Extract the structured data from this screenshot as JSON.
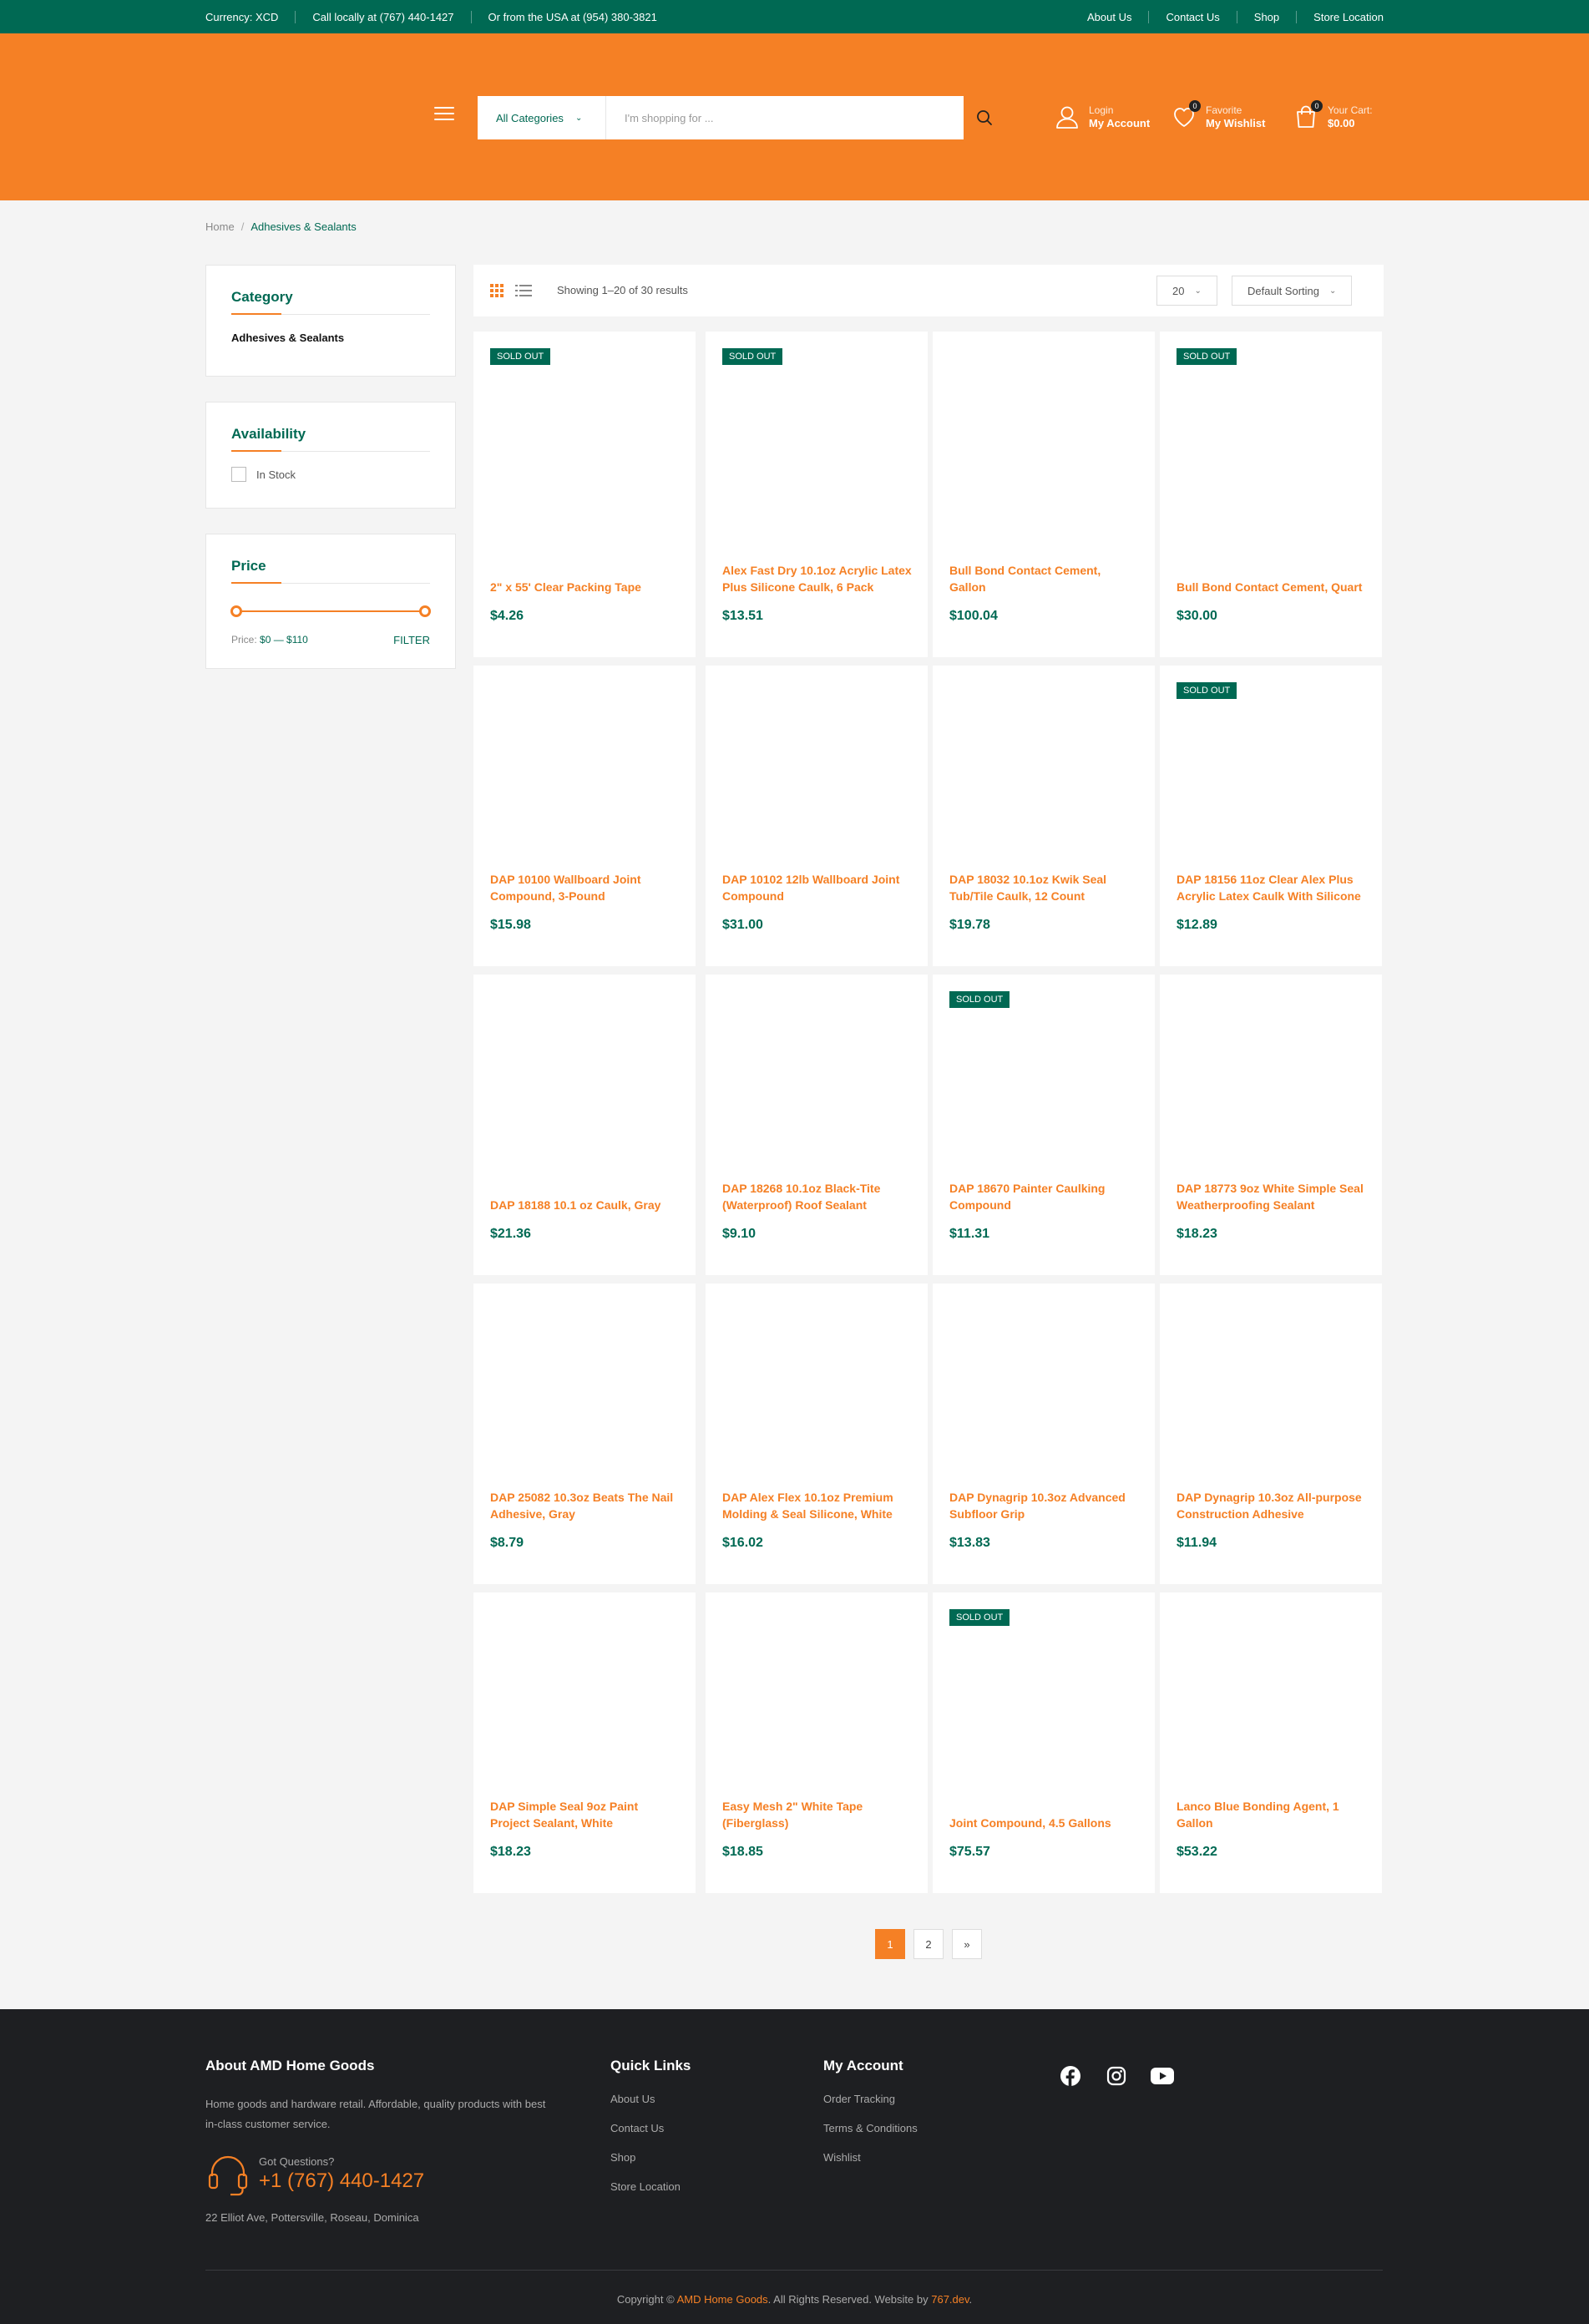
{
  "topbar": {
    "currency": "Currency: XCD",
    "call_local": "Call locally at (767) 440-1427",
    "call_usa": "Or from the USA at (954) 380-3821",
    "links": [
      "About Us",
      "Contact Us",
      "Shop",
      "Store Location"
    ]
  },
  "header": {
    "category_select": "All Categories",
    "search_placeholder": "I'm shopping for ...",
    "account": {
      "small": "Login",
      "big": "My Account"
    },
    "wishlist": {
      "small": "Favorite",
      "big": "My Wishlist",
      "count": "0"
    },
    "cart": {
      "small": "Your Cart:",
      "big": "$0.00",
      "count": "0"
    }
  },
  "breadcrumb": {
    "home": "Home",
    "sep": "/",
    "current": "Adhesives & Sealants"
  },
  "sidebar": {
    "category": {
      "title": "Category",
      "item": "Adhesives & Sealants"
    },
    "availability": {
      "title": "Availability",
      "option": "In Stock"
    },
    "price": {
      "title": "Price",
      "label": "Price:",
      "range": "$0 — $110",
      "filter": "FILTER",
      "min_fraction": 0,
      "max_fraction": 1
    }
  },
  "toolbar": {
    "results": "Showing 1–20 of 30 results",
    "per_page": "20",
    "sorting": "Default Sorting"
  },
  "sold_out_label": "SOLD OUT",
  "products": [
    {
      "name": "2\" x 55' Clear Packing Tape",
      "price": "$4.26",
      "sold_out": true
    },
    {
      "name": "Alex Fast Dry 10.1oz Acrylic Latex Plus Silicone Caulk, 6 Pack",
      "price": "$13.51",
      "sold_out": true
    },
    {
      "name": "Bull Bond Contact Cement, Gallon",
      "price": "$100.04",
      "sold_out": false
    },
    {
      "name": "Bull Bond Contact Cement, Quart",
      "price": "$30.00",
      "sold_out": true
    },
    {
      "name": "DAP 10100 Wallboard Joint Compound, 3-Pound",
      "price": "$15.98",
      "sold_out": false
    },
    {
      "name": "DAP 10102 12lb Wallboard Joint Compound",
      "price": "$31.00",
      "sold_out": false
    },
    {
      "name": "DAP 18032 10.1oz Kwik Seal Tub/Tile Caulk, 12 Count",
      "price": "$19.78",
      "sold_out": false
    },
    {
      "name": "DAP 18156 11oz Clear Alex Plus Acrylic Latex Caulk With Silicone",
      "price": "$12.89",
      "sold_out": true
    },
    {
      "name": "DAP 18188 10.1 oz Caulk, Gray",
      "price": "$21.36",
      "sold_out": false
    },
    {
      "name": "DAP 18268 10.1oz Black-Tite (Waterproof) Roof Sealant",
      "price": "$9.10",
      "sold_out": false
    },
    {
      "name": "DAP 18670 Painter Caulking Compound",
      "price": "$11.31",
      "sold_out": true
    },
    {
      "name": "DAP 18773 9oz White Simple Seal Weatherproofing Sealant",
      "price": "$18.23",
      "sold_out": false
    },
    {
      "name": "DAP 25082 10.3oz Beats The Nail Adhesive, Gray",
      "price": "$8.79",
      "sold_out": false
    },
    {
      "name": "DAP Alex Flex 10.1oz Premium Molding & Seal Silicone, White",
      "price": "$16.02",
      "sold_out": false
    },
    {
      "name": "DAP Dynagrip 10.3oz Advanced Subfloor Grip",
      "price": "$13.83",
      "sold_out": false
    },
    {
      "name": "DAP Dynagrip 10.3oz All-purpose Construction Adhesive",
      "price": "$11.94",
      "sold_out": false
    },
    {
      "name": "DAP Simple Seal 9oz Paint Project Sealant, White",
      "price": "$18.23",
      "sold_out": false
    },
    {
      "name": "Easy Mesh 2\" White Tape (Fiberglass)",
      "price": "$18.85",
      "sold_out": false
    },
    {
      "name": "Joint Compound, 4.5 Gallons",
      "price": "$75.57",
      "sold_out": true
    },
    {
      "name": "Lanco Blue Bonding Agent, 1 Gallon",
      "price": "$53.22",
      "sold_out": false
    }
  ],
  "pagination": {
    "pages": [
      "1",
      "2"
    ],
    "next": "»",
    "current": "1"
  },
  "footer": {
    "about_title": "About AMD Home Goods",
    "about_text": "Home goods and hardware retail. Affordable, quality products with best in-class customer service.",
    "questions": "Got Questions?",
    "phone": "+1 (767) 440-1427",
    "address": "22 Elliot Ave, Pottersville, Roseau, Dominica",
    "quick_links_title": "Quick Links",
    "quick_links": [
      "About Us",
      "Contact Us",
      "Shop",
      "Store Location"
    ],
    "account_title": "My Account",
    "account_links": [
      "Order Tracking",
      "Terms & Conditions",
      "Wishlist"
    ],
    "copy_pre": "Copyright ©",
    "copy_brand": "AMD Home Goods",
    "copy_mid": ". All Rights Reserved. Website by",
    "copy_dev": "767.dev",
    "copy_end": "."
  },
  "colors": {
    "primary_green": "#006953",
    "accent_orange": "#f58025",
    "footer_bg": "#1e1f22"
  }
}
